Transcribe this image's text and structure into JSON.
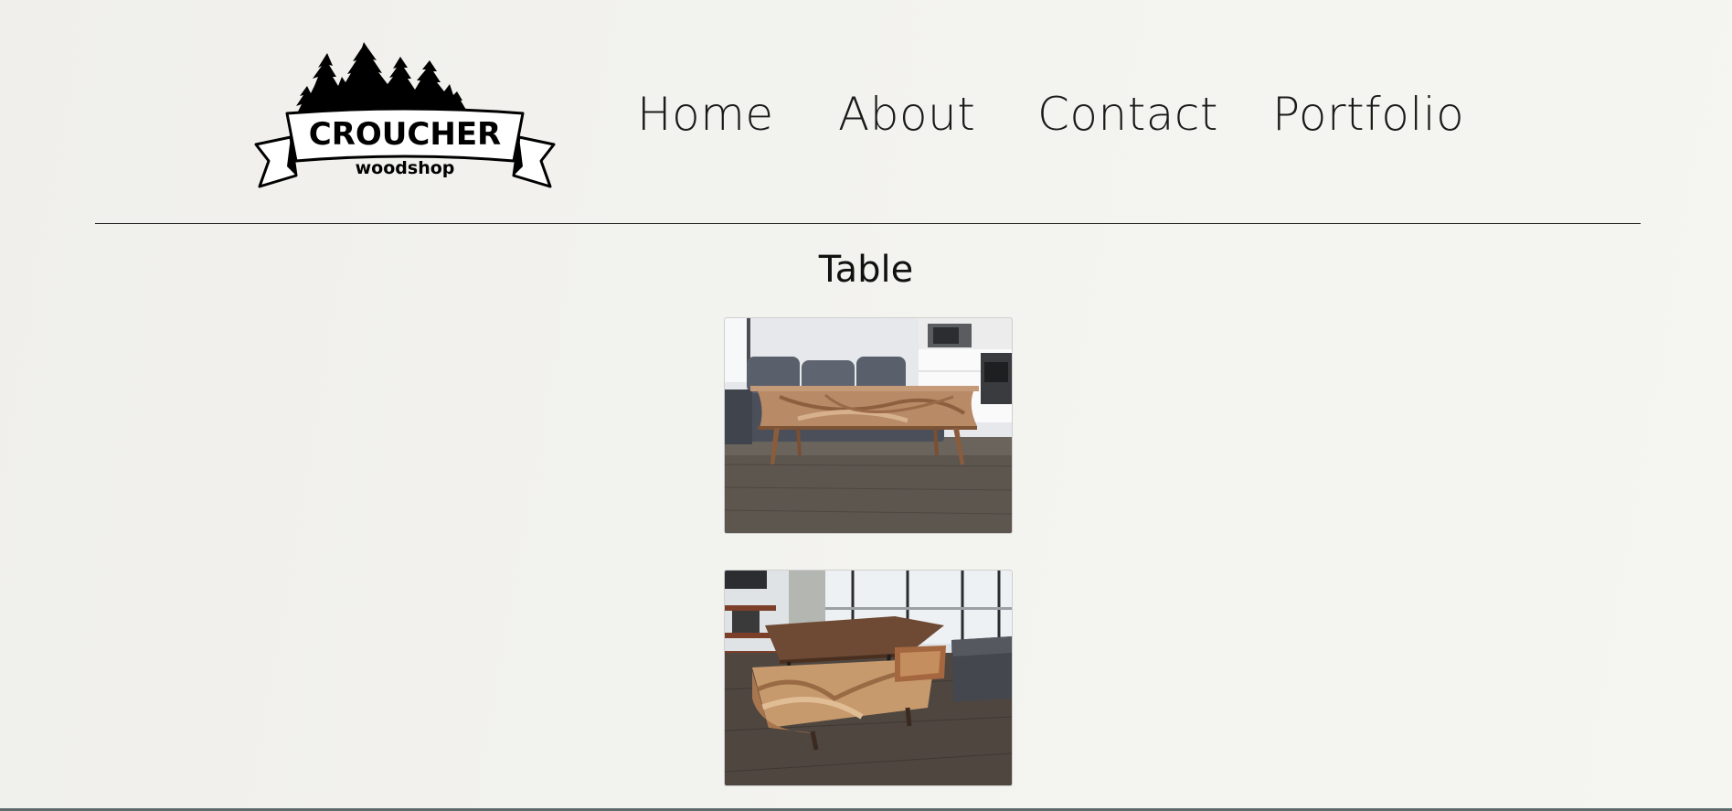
{
  "brand": {
    "name": "CROUCHER",
    "tagline": "woodshop"
  },
  "nav": {
    "items": [
      {
        "label": "Home"
      },
      {
        "label": "About"
      },
      {
        "label": "Contact"
      },
      {
        "label": "Portfolio"
      }
    ]
  },
  "section": {
    "title": "Table"
  },
  "gallery": {
    "photos": [
      {
        "subject": "wood coffee table in living room, front view"
      },
      {
        "subject": "lift-top wood coffee table with drawer open"
      }
    ]
  },
  "colors": {
    "background": "#f2f2ee",
    "text": "#111111",
    "divider": "#222222"
  }
}
